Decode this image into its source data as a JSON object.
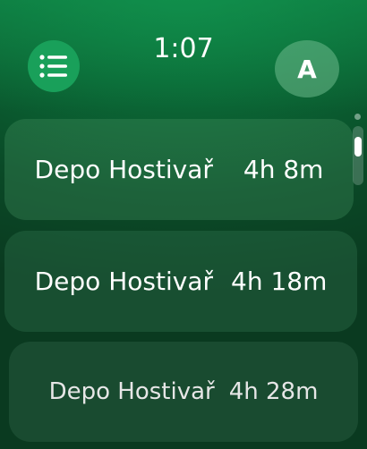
{
  "status": {
    "time": "1:07"
  },
  "header": {
    "menu_icon": "list-bullet-icon",
    "avatar_letter": "A"
  },
  "trips": [
    {
      "name": "Depo Hostivař",
      "duration": "4h 8m"
    },
    {
      "name": "Depo Hostivař",
      "duration": "4h 18m"
    },
    {
      "name": "Depo Hostivař",
      "duration": "4h 28m"
    }
  ],
  "colors": {
    "accent": "#19a05a",
    "background": "#0a4a27"
  }
}
